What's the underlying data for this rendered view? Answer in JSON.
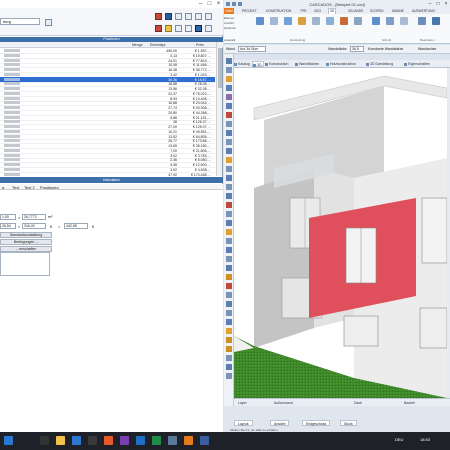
{
  "left": {
    "combo_value": "berg",
    "grid_header": "Positionen",
    "columns": {
      "menge": "Menge",
      "einheit": "Einheitspr.",
      "preis": "Preis"
    },
    "rows": [
      {
        "menge": "450,00",
        "preis": "€ 1.557,…"
      },
      {
        "menge": "0,13",
        "preis": "€ 19.807,…"
      },
      {
        "menge": "24,01",
        "preis": "€ 77.819,…"
      },
      {
        "menge": "10,08",
        "preis": "€ 11.466,…"
      },
      {
        "menge": "16,48",
        "preis": "€ 35.772,…"
      },
      {
        "menge": "3,42",
        "preis": "€ 1.043,…"
      },
      {
        "menge": "36,36",
        "preis": "€ 15.57,…",
        "selected": true
      },
      {
        "menge": "18,88",
        "preis": "€ 28.08,…"
      },
      {
        "menge": "13,56",
        "preis": "€ 32.38,…"
      },
      {
        "menge": "22,37",
        "preis": "€ 75.022,…"
      },
      {
        "menge": "8,93",
        "preis": "€ 10.408,…"
      },
      {
        "menge": "16,88",
        "preis": "€ 24.044,…"
      },
      {
        "menge": "27,74",
        "preis": "€ 93.306,…"
      },
      {
        "menge": "20,80",
        "preis": "€ 44.268,…"
      },
      {
        "menge": "6,88",
        "preis": "€ 21.151,…"
      },
      {
        "menge": "28",
        "preis": "€ 126.37,…"
      },
      {
        "menge": "27,00",
        "preis": "€ 125.07,…"
      },
      {
        "menge": "10,21",
        "preis": "€ 49.551,…"
      },
      {
        "menge": "13,52",
        "preis": "€ 64.805,…"
      },
      {
        "menge": "26,77",
        "preis": "€ 173.66,…"
      },
      {
        "menge": "13,65",
        "preis": "€ 35.180,…"
      },
      {
        "menge": "7,00",
        "preis": "€ 21.805,…"
      },
      {
        "menge": "3,02",
        "preis": "€ 3.783,…"
      },
      {
        "menge": "2,36",
        "preis": "€ 5.080,…"
      },
      {
        "menge": "9,08",
        "preis": "€ 12.600,…"
      },
      {
        "menge": "3,52",
        "preis": "€ 4.508,…"
      },
      {
        "menge": "47,00",
        "preis": "€ 174.468,…"
      }
    ],
    "mid_bar": "Kalkulation",
    "pos_head": {
      "a": "a",
      "b": "Text",
      "c": "Text 2",
      "d": "Positionen"
    },
    "calc": {
      "v1": "1,00",
      "v2": "26,7772",
      "v3": "m²",
      "v4": "26,54",
      "v5": "316,40",
      "v6": "€",
      "v7": "=",
      "v8": "442,58",
      "v9": "€",
      "btn1": "Standardausstattung",
      "btn2": "Bedingungen ...",
      "btn3": "…enschaften"
    }
  },
  "right": {
    "title": "CASCADOS - [Beispiel 01.cod]",
    "tabs": [
      "PROJEKT",
      "KONSTRUKTION",
      "TPR",
      "GEO",
      "3D",
      "GELÄNDE",
      "SCOPEN",
      "WANNE",
      "AUSWERTUNG"
    ],
    "file_tab": "Datei",
    "ribbon_groups": [
      "Darstellung",
      "Schnitt",
      "Bearbeiten"
    ],
    "ribbon_left": [
      "Ebenen",
      "Ansicht",
      "Optionen",
      "Auswahl"
    ],
    "view_tabs": [
      "Katalog",
      "3D",
      "Konstruktion",
      "Wandflächen",
      "Holzkonstruktion",
      "3D Darstellung",
      "Eigenschaften"
    ],
    "toolbar2": {
      "label": "Wand",
      "field": "Ant 3d Süm",
      "w1": "Wandstärke",
      "v1": "36,5",
      "w2": "Konstante Wandstärke",
      "w3": "Wandachse"
    },
    "status": [
      "Layer",
      "Außenwand",
      "Dach",
      "Bauteil"
    ],
    "bottom_tabs": [
      "Layout",
      "Ansicht",
      "Erdgeschoss",
      "Stock"
    ],
    "bottom_status": "Klicken Sie F1, um Hilfe zu erhalten",
    "colors": {
      "accent": "#e67a1e",
      "red_wall": "#e0505c",
      "grass": "#3f8a2a"
    }
  },
  "taskbar": {
    "time": "18:53",
    "date": "DEU"
  }
}
